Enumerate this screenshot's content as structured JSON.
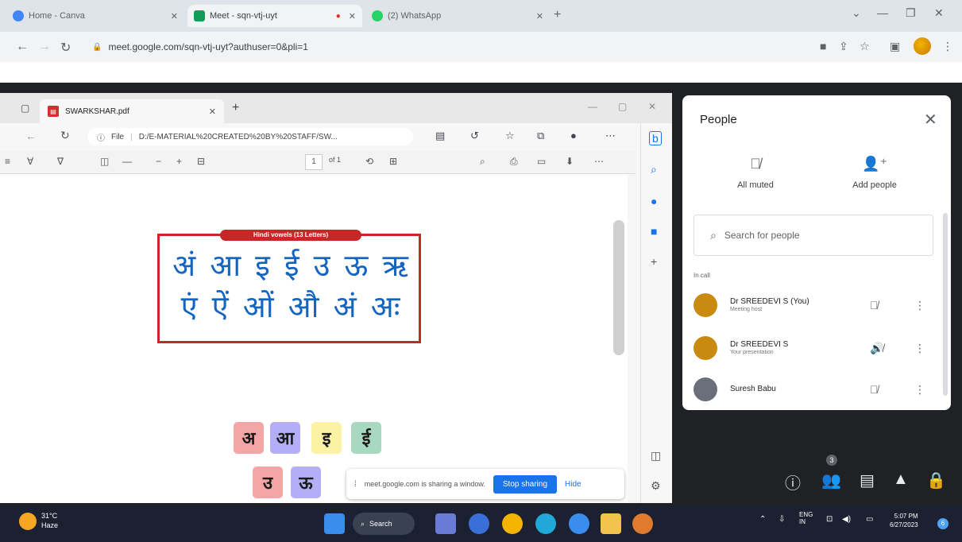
{
  "outer_browser": {
    "tabs": [
      {
        "label": "Home - Canva",
        "active": false
      },
      {
        "label": "Meet - sqn-vtj-uyt",
        "active": true
      },
      {
        "label": "(2) WhatsApp",
        "active": false
      }
    ],
    "address": "meet.google.com/sqn-vtj-uyt?authuser=0&pli=1"
  },
  "edge": {
    "tab_title": "SWARKSHAR.pdf",
    "address": "D:/E-MATERIAL%20CREATED%20BY%20STAFF/SW...",
    "address_prefix": "File",
    "page_number": "1",
    "page_total": "of 1"
  },
  "pdf": {
    "card_header": "Hindi vowels (13 Letters)",
    "vowels_line1": "अं आ इ ई उ ऊ ऋ",
    "vowels_line2": "एं ऐं ओं औ अं अः",
    "tiles": [
      {
        "letter": "अ",
        "color": "#f4a5a5"
      },
      {
        "letter": "आ",
        "color": "#b3aef5"
      },
      {
        "letter": "इ",
        "color": "#fbf3a3"
      },
      {
        "letter": "ई",
        "color": "#a8d8c0"
      },
      {
        "letter": "उ",
        "color": "#f4a5a5"
      },
      {
        "letter": "ऊ",
        "color": "#b3aef5"
      }
    ]
  },
  "share_bar": {
    "message": "meet.google.com is sharing a window.",
    "stop_label": "Stop sharing",
    "hide_label": "Hide"
  },
  "people_panel": {
    "title": "People",
    "all_muted": "All muted",
    "add_people": "Add people",
    "search_placeholder": "Search for people",
    "section": "In call",
    "participants": [
      {
        "name": "Dr SREEDEVI S (You)",
        "sub": "Meeting host",
        "avatar": "#c98a12"
      },
      {
        "name": "Dr SREEDEVI S",
        "sub": "Your presentation",
        "avatar": "#c98a12"
      },
      {
        "name": "Suresh Babu",
        "sub": "",
        "avatar": "#6b6f7a"
      }
    ]
  },
  "meet_controls": {
    "participant_count": "3"
  },
  "taskbar": {
    "temperature": "31°C",
    "weather_text": "Haze",
    "search_label": "Search",
    "language": "ENG",
    "language_sub": "IN",
    "time": "5:07 PM",
    "date": "6/27/2023",
    "notifications": "6"
  },
  "colors": {
    "accent": "#1a73e8",
    "card_border": "#c62828",
    "vowel_text": "#1565c0"
  }
}
